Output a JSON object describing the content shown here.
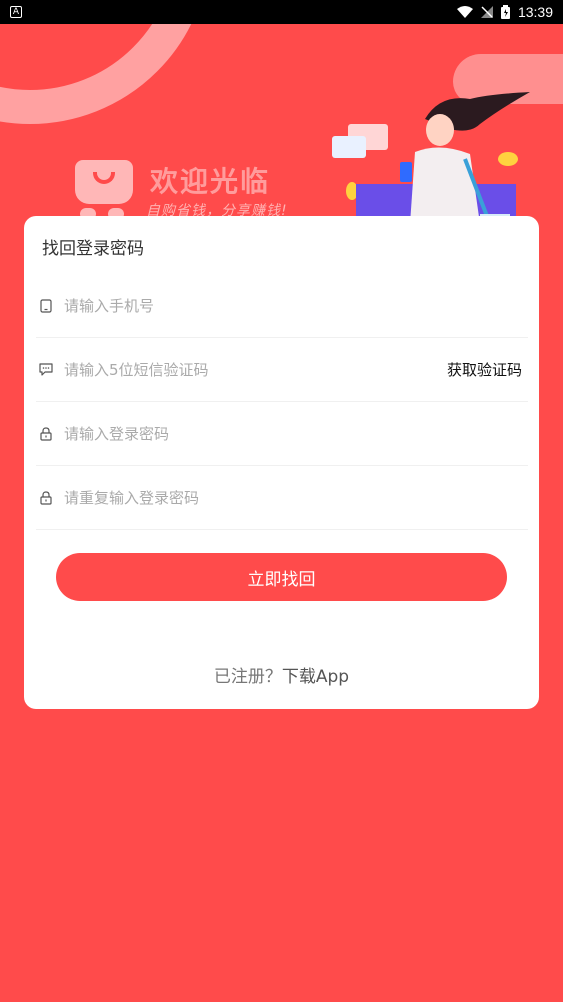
{
  "status_bar": {
    "left_badge": "A",
    "time": "13:39"
  },
  "hero": {
    "welcome": "欢迎光临",
    "slogan": "自购省钱，分享赚钱!"
  },
  "card": {
    "title": "找回登录密码",
    "fields": [
      {
        "placeholder": "请输入手机号",
        "icon": "phone-icon"
      },
      {
        "placeholder": "请输入5位短信验证码",
        "icon": "message-icon",
        "action": "获取验证码"
      },
      {
        "placeholder": "请输入登录密码",
        "icon": "lock-icon"
      },
      {
        "placeholder": "请重复输入登录密码",
        "icon": "lock-icon"
      }
    ],
    "submit": "立即找回",
    "footer_prefix": "已注册？",
    "footer_link": "下载App"
  },
  "colors": {
    "brand": "#ff4b4b",
    "card": "#ffffff",
    "placeholder": "#aaaaaa"
  }
}
